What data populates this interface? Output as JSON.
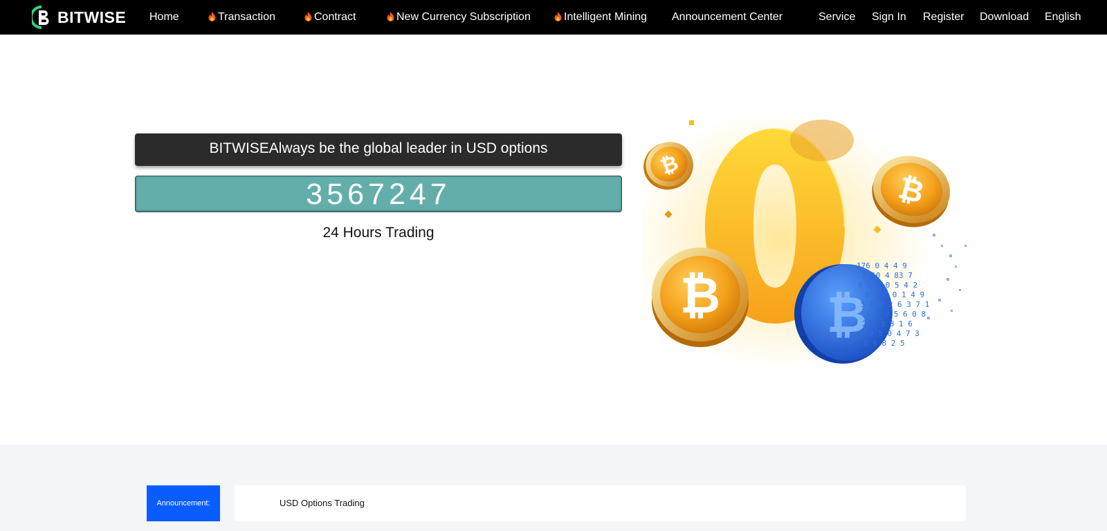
{
  "brand": {
    "name": "BITWISE",
    "accent": "#2fd48a"
  },
  "nav": {
    "home": "Home",
    "transaction": "Transaction",
    "contract": "Contract",
    "subscription": "New Currency Subscription",
    "mining": "Intelligent Mining",
    "announcements": "Announcement Center",
    "service": "Service",
    "signin": "Sign In",
    "register": "Register",
    "download": "Download",
    "language": "English",
    "hot_icon": "fire-icon"
  },
  "hero": {
    "headline": "BITWISEAlways be the global leader in USD options",
    "counter": "3567247",
    "caption": "24 Hours Trading",
    "counter_color": "#63aeaa"
  },
  "announcement": {
    "label": "Announcement:",
    "text": "USD Options Trading",
    "label_color": "#0a5cff"
  }
}
